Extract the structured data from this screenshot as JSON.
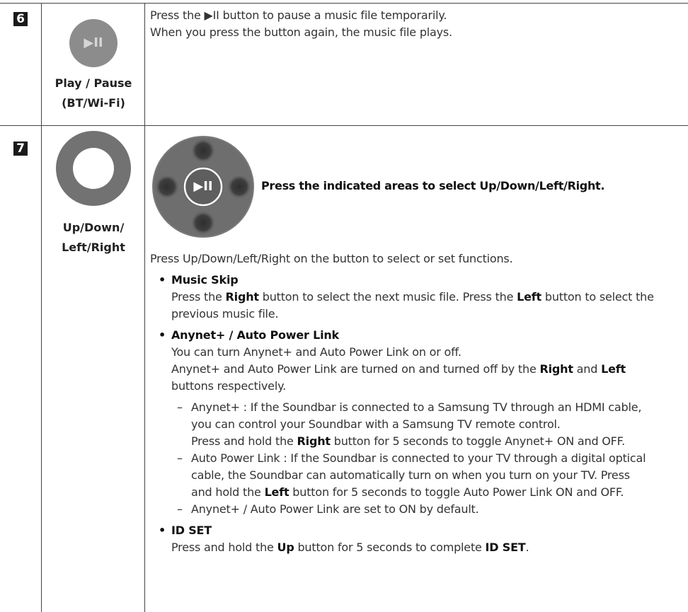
{
  "rows": [
    {
      "number": "6",
      "caption_line1": "Play / Pause",
      "caption_line2": "(BT/Wi-Fi)",
      "icon_glyph": "▶II",
      "desc_line1": "Press the ▶II button to pause a music file temporarily.",
      "desc_line2": "When you press the button again, the music file plays."
    },
    {
      "number": "7",
      "caption_line1": "Up/Down/",
      "caption_line2": "Left/Right",
      "dpad_center_glyph": "▶II",
      "headline": "Press the indicated areas to select Up/Down/Left/Right.",
      "intro": "Press Up/Down/Left/Right on the button to select or set functions.",
      "music_skip": {
        "title": "Music Skip",
        "t1": "Press the ",
        "b1": "Right",
        "t2": " button to select the next music file. Press the ",
        "b2": "Left",
        "t3": " button to select the",
        "line2": "previous music file."
      },
      "anynet": {
        "title": "Anynet+ / Auto Power Link",
        "line1": "You can turn Anynet+ and Auto Power Link on or off.",
        "line2a": "Anynet+ and Auto Power Link are turned on and turned off by the ",
        "line2b": "Right",
        "line2c": " and ",
        "line2d": "Left",
        "line3": "buttons respectively.",
        "d1_line1": "Anynet+ : If the Soundbar is connected to a Samsung TV through an HDMI cable,",
        "d1_line2": "you can control your Soundbar with a Samsung TV remote control.",
        "d1_line3a": "Press and hold the ",
        "d1_line3b": "Right",
        "d1_line3c": " button for 5 seconds to toggle Anynet+ ON and OFF.",
        "d2_line1": "Auto Power Link : If the Soundbar is connected to your TV through a digital optical",
        "d2_line2": "cable, the Soundbar can automatically turn on when you turn on your TV. Press",
        "d2_line3a": "and hold the ",
        "d2_line3b": "Left",
        "d2_line3c": " button for 5 seconds to toggle Auto Power Link ON and OFF.",
        "d3_line1": "Anynet+ / Auto Power Link are set to ON by default."
      },
      "id_set": {
        "title": "ID SET",
        "t1": "Press and hold the ",
        "b1": "Up",
        "t2": " button for 5 seconds to complete ",
        "b2": "ID SET",
        "t3": "."
      }
    }
  ],
  "colors": {
    "badge_bg": "#1a1a1a",
    "button_gray": "#6b6b6b",
    "button_gray_light": "#8a8a8a",
    "rule": "#444444"
  }
}
